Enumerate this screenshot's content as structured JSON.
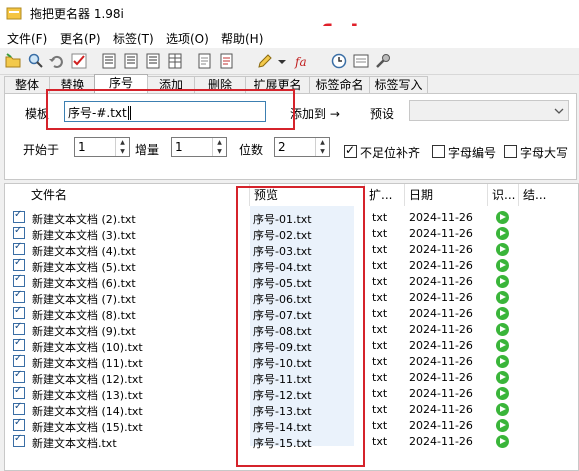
{
  "window": {
    "title": "拖把更名器 1.98i"
  },
  "watermark": "fubaya.com",
  "menu": [
    "文件(F)",
    "更名(P)",
    "标签(T)",
    "选项(O)",
    "帮助(H)"
  ],
  "tabs": [
    "整体",
    "替换",
    "序号",
    "添加",
    "删除",
    "扩展更名",
    "标签命名",
    "标签写入"
  ],
  "form": {
    "template_label": "模板",
    "template_value": "序号-#.txt",
    "add_to_label": "添加到 →",
    "preset_label": "预设",
    "start_label": "开始于",
    "start_value": "1",
    "step_label": "增量",
    "step_value": "1",
    "digits_label": "位数",
    "digits_value": "2",
    "pad_label": "不足位补齐",
    "letter_num_label": "字母编号",
    "upper_label": "字母大写"
  },
  "table": {
    "columns": [
      "文件名",
      "预览",
      "扩...",
      "日期",
      "识...",
      "结..."
    ],
    "rows": [
      {
        "name": "新建文本文档 (2).txt",
        "preview": "序号-01.txt",
        "ext": "txt",
        "date": "2024-11-26"
      },
      {
        "name": "新建文本文档 (3).txt",
        "preview": "序号-02.txt",
        "ext": "txt",
        "date": "2024-11-26"
      },
      {
        "name": "新建文本文档 (4).txt",
        "preview": "序号-03.txt",
        "ext": "txt",
        "date": "2024-11-26"
      },
      {
        "name": "新建文本文档 (5).txt",
        "preview": "序号-04.txt",
        "ext": "txt",
        "date": "2024-11-26"
      },
      {
        "name": "新建文本文档 (6).txt",
        "preview": "序号-05.txt",
        "ext": "txt",
        "date": "2024-11-26"
      },
      {
        "name": "新建文本文档 (7).txt",
        "preview": "序号-06.txt",
        "ext": "txt",
        "date": "2024-11-26"
      },
      {
        "name": "新建文本文档 (8).txt",
        "preview": "序号-07.txt",
        "ext": "txt",
        "date": "2024-11-26"
      },
      {
        "name": "新建文本文档 (9).txt",
        "preview": "序号-08.txt",
        "ext": "txt",
        "date": "2024-11-26"
      },
      {
        "name": "新建文本文档 (10).txt",
        "preview": "序号-09.txt",
        "ext": "txt",
        "date": "2024-11-26"
      },
      {
        "name": "新建文本文档 (11).txt",
        "preview": "序号-10.txt",
        "ext": "txt",
        "date": "2024-11-26"
      },
      {
        "name": "新建文本文档 (12).txt",
        "preview": "序号-11.txt",
        "ext": "txt",
        "date": "2024-11-26"
      },
      {
        "name": "新建文本文档 (13).txt",
        "preview": "序号-12.txt",
        "ext": "txt",
        "date": "2024-11-26"
      },
      {
        "name": "新建文本文档 (14).txt",
        "preview": "序号-13.txt",
        "ext": "txt",
        "date": "2024-11-26"
      },
      {
        "name": "新建文本文档 (15).txt",
        "preview": "序号-14.txt",
        "ext": "txt",
        "date": "2024-11-26"
      },
      {
        "name": "新建文本文档.txt",
        "preview": "序号-15.txt",
        "ext": "txt",
        "date": "2024-11-26"
      }
    ]
  },
  "colors": {
    "highlight_box": "#d5232b",
    "watermark": "#e0202a",
    "status_ok": "#3ab53a",
    "preview_bg": "#eaf2fb"
  },
  "icons": [
    "open-folder-icon",
    "search-icon",
    "undo-icon",
    "check-icon",
    "number-list-icon",
    "number-list-2-icon",
    "number-list-3-icon",
    "table-icon",
    "document-icon",
    "pencil-icon",
    "letters-icon",
    "clock-icon",
    "tag-icon",
    "tools-icon"
  ]
}
